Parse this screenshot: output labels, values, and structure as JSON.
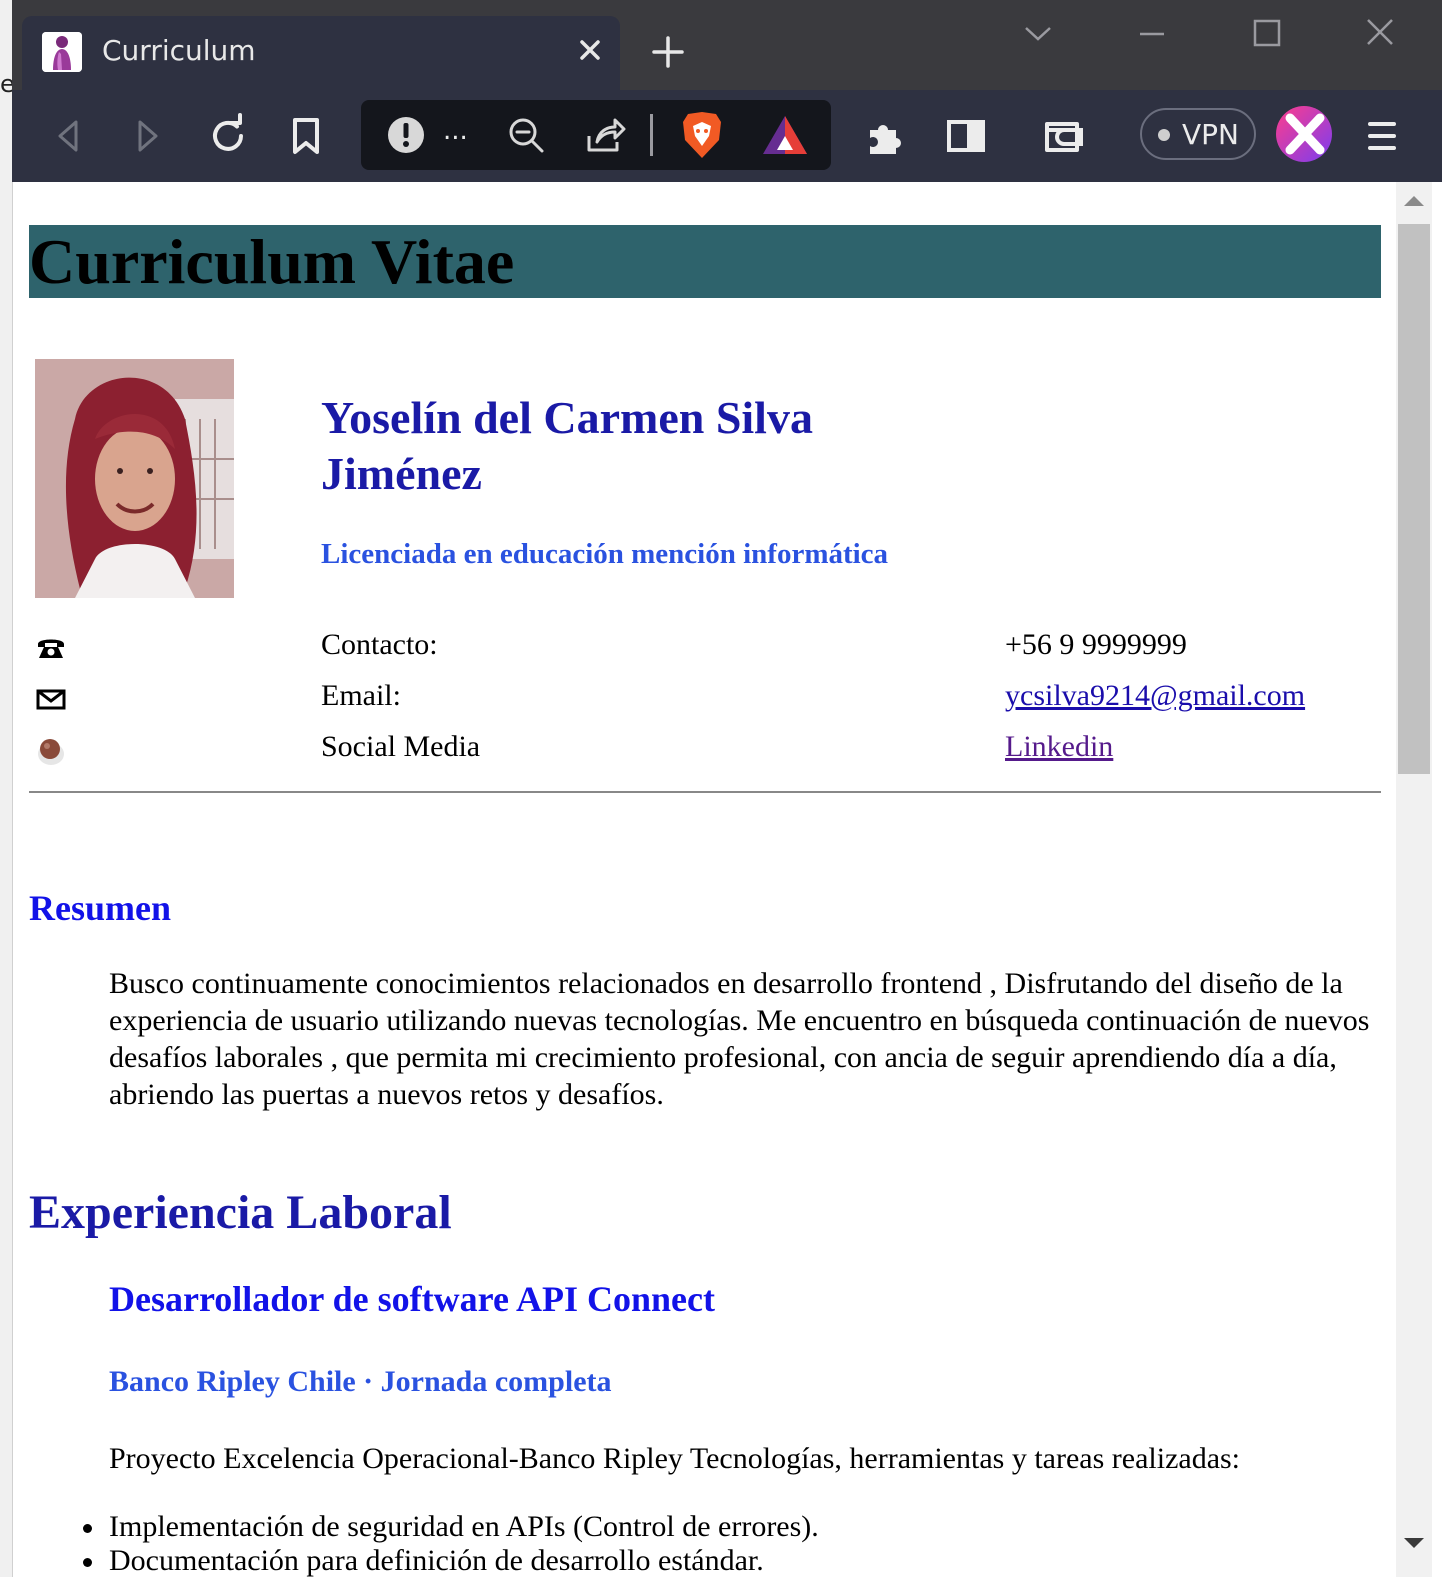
{
  "browser": {
    "left_edge_text": "e:",
    "tab_title": "Curriculum",
    "vpn_label": "VPN",
    "url_more": "..."
  },
  "page": {
    "title": "Curriculum Vitae",
    "name_line1": "Yoselín del Carmen Silva",
    "name_line2": "Jiménez",
    "subtitle": "Licenciada en educación mención informática",
    "contact": [
      {
        "icon": "phone-icon",
        "label": "Contacto:",
        "value": "+56 9 9999999"
      },
      {
        "icon": "mail-icon",
        "label": "Email:",
        "value": "ycsilva9214@gmail.com"
      },
      {
        "icon": "social-media-icon",
        "label": "Social Media",
        "value": "Linkedin"
      }
    ],
    "resumen_heading": "Resumen",
    "resumen_text": "Busco continuamente conocimientos relacionados en desarrollo frontend , Disfrutando del diseño de la experiencia de usuario utilizando nuevas tecnologías. Me encuentro en búsqueda continuación de nuevos desafíos laborales , que permita mi crecimiento profesional, con ancia de seguir aprendiendo día a día, abriendo las puertas a nuevos retos y desafíos.",
    "experience_heading": "Experiencia Laboral",
    "job_title": "Desarrollador de software API Connect",
    "company": "Banco Ripley Chile · Jornada completa",
    "project_intro": "Proyecto Excelencia Operacional-Banco Ripley Tecnologías, herramientas y tareas realizadas:",
    "tasks": [
      "Implementación de seguridad en APIs (Control de errores).",
      "Documentación para definición de desarrollo estándar."
    ]
  },
  "colors": {
    "title_band": "#2e636c",
    "heading_blue": "#1a1aa6",
    "accent_blue": "#2a52e0",
    "chrome_dark": "#2e3141"
  }
}
